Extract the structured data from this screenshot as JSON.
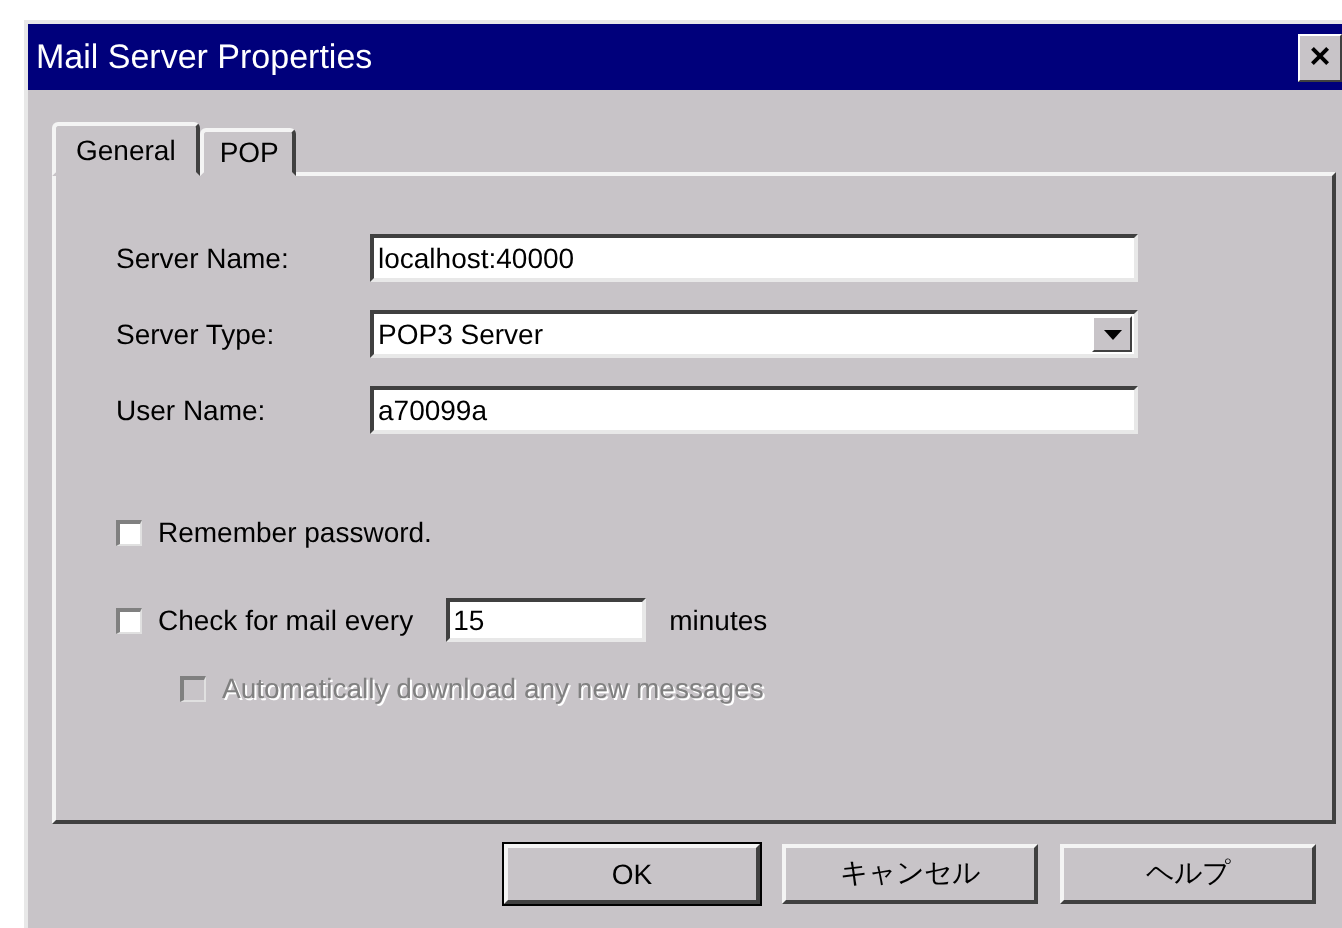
{
  "window": {
    "title": "Mail Server Properties",
    "close": "×"
  },
  "tabs": [
    {
      "label": "General",
      "selected": true
    },
    {
      "label": "POP",
      "selected": false
    }
  ],
  "fields": [
    {
      "label": "Server Name:",
      "value": "localhost:40000",
      "kind": "text"
    },
    {
      "label": "Server Type:",
      "value": "POP3 Server",
      "kind": "combo"
    },
    {
      "label": "User Name:",
      "value": "a70099a",
      "kind": "text"
    }
  ],
  "remember_password": {
    "label": "Remember password.",
    "checked": false,
    "disabled": false
  },
  "check_mail": {
    "label": "Check for mail every",
    "checked": false,
    "disabled": false,
    "interval": "15",
    "unit": "minutes"
  },
  "auto_download": {
    "label": "Automatically download any new messages",
    "checked": false,
    "disabled": true
  },
  "buttons": [
    {
      "label": "OK",
      "default": true
    },
    {
      "label": "キャンセル",
      "default": false
    },
    {
      "label": "ヘルプ",
      "default": false
    }
  ]
}
